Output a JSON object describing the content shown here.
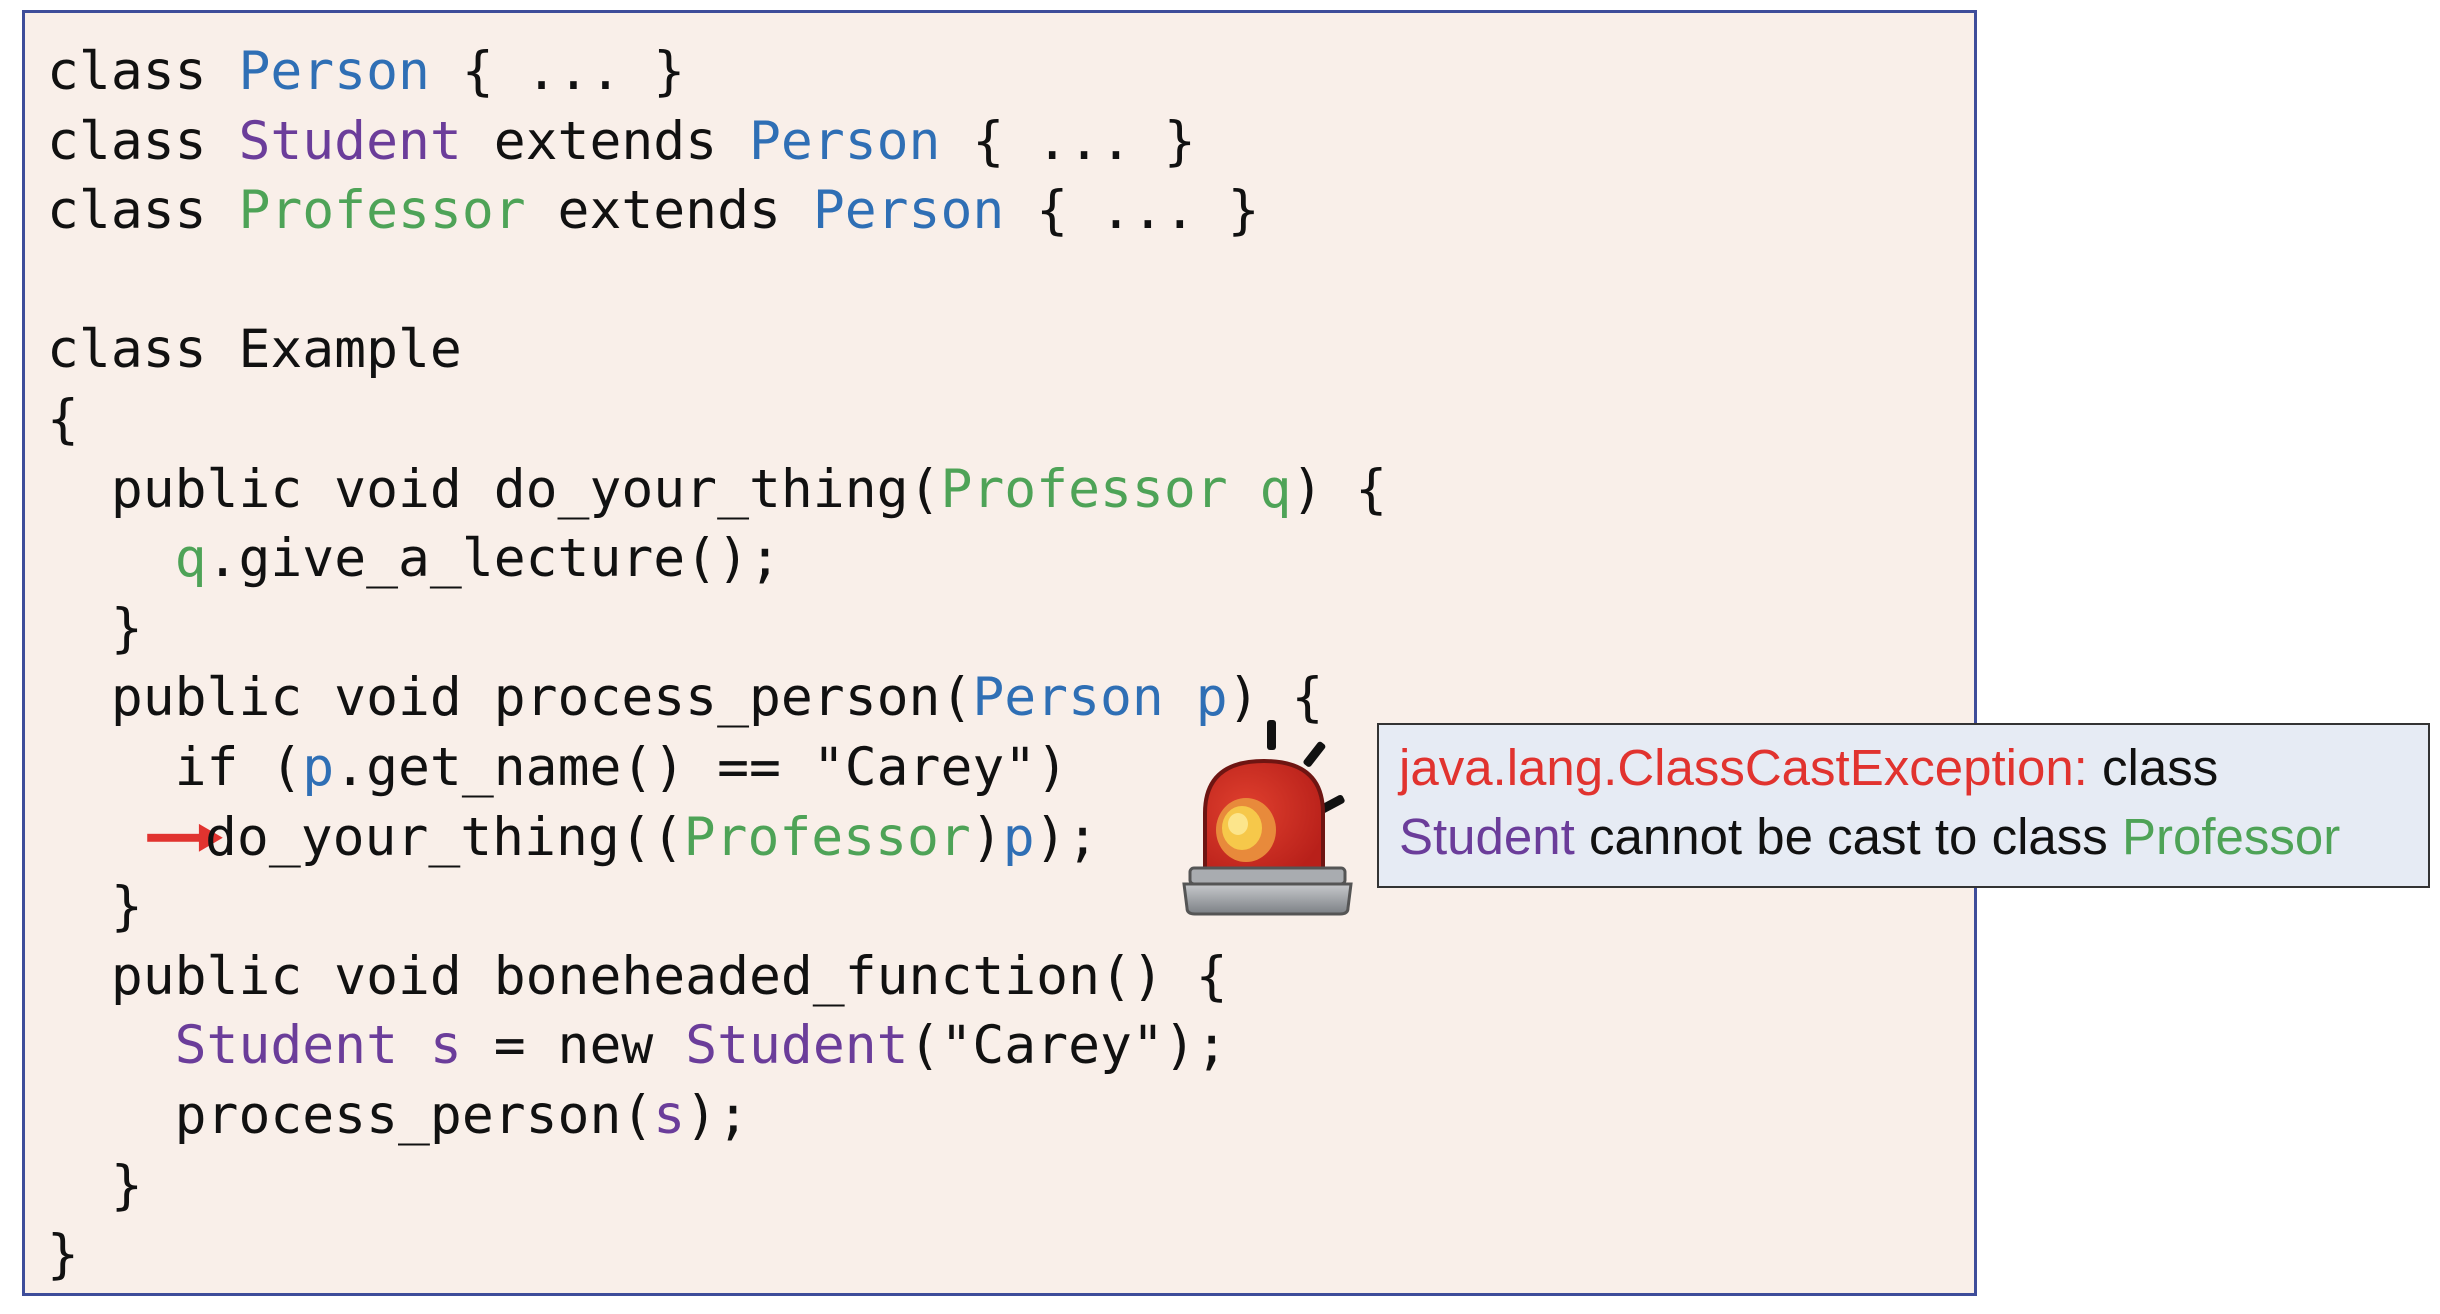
{
  "colors": {
    "panel_background": "#f9efe9",
    "panel_border": "#3e4d9a",
    "type_person": "#2f6fb5",
    "type_student": "#6b3d9a",
    "type_professor": "#4ea357",
    "arrow": "#e1332f",
    "exception_name": "#e1332f",
    "error_background": "#e6ebf4"
  },
  "code": {
    "lines": [
      [
        {
          "t": "class ",
          "c": "plain"
        },
        {
          "t": "Person",
          "c": "blue"
        },
        {
          "t": " { ... }",
          "c": "plain"
        }
      ],
      [
        {
          "t": "class ",
          "c": "plain"
        },
        {
          "t": "Student",
          "c": "purple"
        },
        {
          "t": " extends ",
          "c": "plain"
        },
        {
          "t": "Person",
          "c": "blue"
        },
        {
          "t": " { ... }",
          "c": "plain"
        }
      ],
      [
        {
          "t": "class ",
          "c": "plain"
        },
        {
          "t": "Professor",
          "c": "green"
        },
        {
          "t": " extends ",
          "c": "plain"
        },
        {
          "t": "Person",
          "c": "blue"
        },
        {
          "t": " { ... }",
          "c": "plain"
        }
      ],
      [],
      [
        {
          "t": "class Example",
          "c": "plain"
        }
      ],
      [
        {
          "t": "{",
          "c": "plain"
        }
      ],
      [
        {
          "t": "  public void do_your_thing(",
          "c": "plain"
        },
        {
          "t": "Professor q",
          "c": "green"
        },
        {
          "t": ") {",
          "c": "plain"
        }
      ],
      [
        {
          "t": "    ",
          "c": "plain"
        },
        {
          "t": "q",
          "c": "green"
        },
        {
          "t": ".give_a_lecture();",
          "c": "plain"
        }
      ],
      [
        {
          "t": "  }",
          "c": "plain"
        }
      ],
      [
        {
          "t": "  public void process_person(",
          "c": "plain"
        },
        {
          "t": "Person p",
          "c": "blue"
        },
        {
          "t": ") {",
          "c": "plain"
        }
      ],
      [
        {
          "t": "    if (",
          "c": "plain"
        },
        {
          "t": "p",
          "c": "blue"
        },
        {
          "t": ".get_name() == \"Carey\")",
          "c": "plain"
        }
      ],
      [
        {
          "arrow": true
        },
        {
          "t": "do_your_thing((",
          "c": "plain"
        },
        {
          "t": "Professor",
          "c": "green"
        },
        {
          "t": ")",
          "c": "plain"
        },
        {
          "t": "p",
          "c": "blue"
        },
        {
          "t": ");",
          "c": "plain"
        }
      ],
      [
        {
          "t": "  }",
          "c": "plain"
        }
      ],
      [
        {
          "t": "  public void boneheaded_function() {",
          "c": "plain"
        }
      ],
      [
        {
          "t": "    ",
          "c": "plain"
        },
        {
          "t": "Student s",
          "c": "purple"
        },
        {
          "t": " = new ",
          "c": "plain"
        },
        {
          "t": "Student",
          "c": "purple"
        },
        {
          "t": "(\"Carey\");",
          "c": "plain"
        }
      ],
      [
        {
          "t": "    process_person(",
          "c": "plain"
        },
        {
          "t": "s",
          "c": "purple"
        },
        {
          "t": ");",
          "c": "plain"
        }
      ],
      [
        {
          "t": "  }",
          "c": "plain"
        }
      ],
      [
        {
          "t": "}",
          "c": "plain"
        }
      ]
    ]
  },
  "current_line_arrow_icon": "right-arrow-icon",
  "alarm_icon": "siren-alarm-icon",
  "error": {
    "exception": "java.lang.ClassCastException:",
    "after_exception": " class",
    "student": "Student",
    "middle": " cannot be cast to class ",
    "professor": "Professor"
  }
}
